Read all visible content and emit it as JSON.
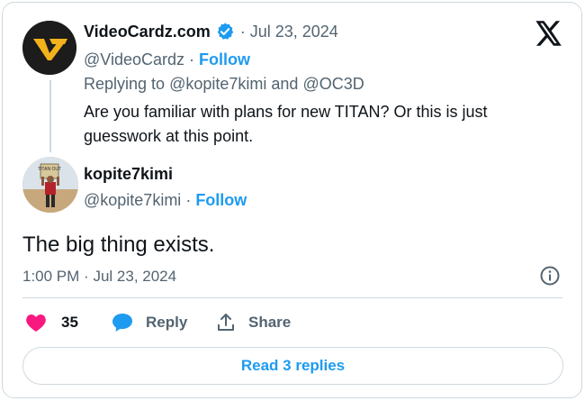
{
  "quoted": {
    "display_name": "VideoCardz.com",
    "date_sep": "·",
    "date": "Jul 23, 2024",
    "handle": "@VideoCardz",
    "follow_sep": "·",
    "follow_label": "Follow",
    "replying_prefix": "Replying to",
    "replying_to_1": "@kopite7kimi",
    "replying_and": "and",
    "replying_to_2": "@OC3D",
    "text_line1": "Are you familiar with plans for new TITAN? Or this is just",
    "text_line2": "guesswork at this point.",
    "verified_icon": "verified-badge-icon",
    "avatar_icon": "videocardz-logo"
  },
  "author": {
    "display_name": "kopite7kimi",
    "handle": "@kopite7kimi",
    "follow_sep": "·",
    "follow_label": "Follow",
    "avatar_sign_text": "TITAN OUT"
  },
  "tweet": {
    "text": "The big thing exists.",
    "time": "1:00 PM",
    "time_sep": "·",
    "date": "Jul 23, 2024"
  },
  "actions": {
    "like_count": "35",
    "reply_label": "Reply",
    "share_label": "Share"
  },
  "footer": {
    "read_replies_label": "Read 3 replies"
  },
  "colors": {
    "accent": "#1d9bf0",
    "like": "#f91880",
    "text": "#0f1419",
    "muted": "#536471",
    "border": "#cfd9de"
  }
}
